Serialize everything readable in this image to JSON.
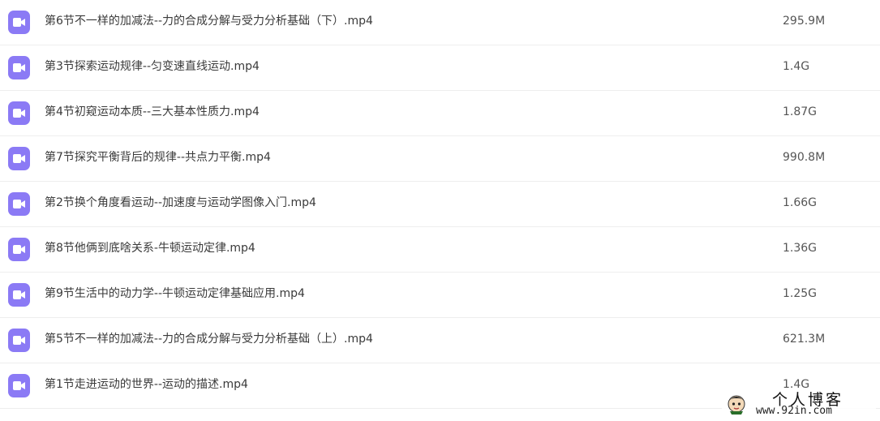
{
  "colors": {
    "video_icon": "#8b7af5",
    "text": "#3a3a3a",
    "divider": "#eeeeee"
  },
  "files": [
    {
      "name": "第6节不一样的加减法--力的合成分解与受力分析基础（下）.mp4",
      "size": "295.9M",
      "icon": "video-icon"
    },
    {
      "name": "第3节探索运动规律--匀变速直线运动.mp4",
      "size": "1.4G",
      "icon": "video-icon"
    },
    {
      "name": "第4节初窥运动本质--三大基本性质力.mp4",
      "size": "1.87G",
      "icon": "video-icon"
    },
    {
      "name": "第7节探究平衡背后的规律--共点力平衡.mp4",
      "size": "990.8M",
      "icon": "video-icon"
    },
    {
      "name": "第2节换个角度看运动--加速度与运动学图像入门.mp4",
      "size": "1.66G",
      "icon": "video-icon"
    },
    {
      "name": "第8节他俩到底啥关系-牛顿运动定律.mp4",
      "size": "1.36G",
      "icon": "video-icon"
    },
    {
      "name": "第9节生活中的动力学--牛顿运动定律基础应用.mp4",
      "size": "1.25G",
      "icon": "video-icon"
    },
    {
      "name": "第5节不一样的加减法--力的合成分解与受力分析基础（上）.mp4",
      "size": "621.3M",
      "icon": "video-icon"
    },
    {
      "name": "第1节走进运动的世界--运动的描述.mp4",
      "size": "1.4G",
      "icon": "video-icon"
    }
  ],
  "watermark": {
    "title": "个人博客",
    "url": "www.92in.com"
  }
}
